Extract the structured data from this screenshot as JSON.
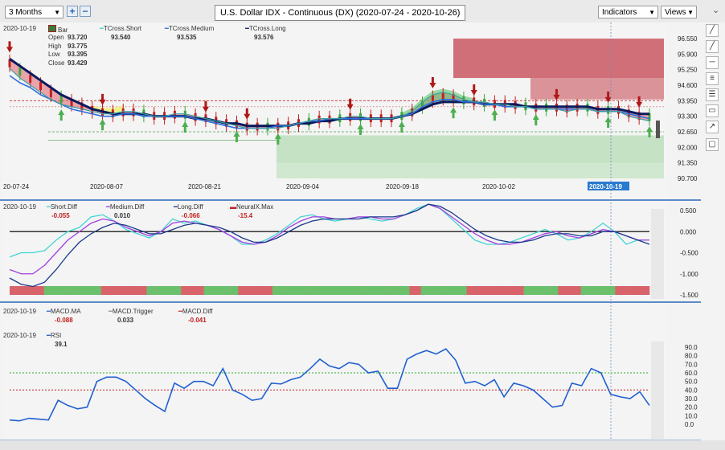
{
  "toolbar": {
    "period": "3 Months",
    "add": "+",
    "remove": "−",
    "title": "U.S. Dollar IDX - Continuous (DX) (2020-07-24 - 2020-10-26)",
    "indicators": "Indicators",
    "views": "Views"
  },
  "price_header": {
    "date": "2020-10-19",
    "bar_label": "Bar",
    "open_label": "Open",
    "open": "93.720",
    "high_label": "High",
    "high": "93.775",
    "low_label": "Low",
    "low": "93.395",
    "close_label": "Close",
    "close": "93.429",
    "tshort_label": "TCross.Short",
    "tshort": "93.540",
    "tmed_label": "TCross.Medium",
    "tmed": "93.535",
    "tlong_label": "TCross.Long",
    "tlong": "93.576"
  },
  "diff_header": {
    "date": "2020-10-19",
    "s_label": "Short.Diff",
    "s": "-0.055",
    "m_label": "Medium.Diff",
    "m": "0.010",
    "l_label": "Long.Diff",
    "l": "-0.066",
    "n_label": "NeuralX.Max",
    "n": "-15.4"
  },
  "macd_header": {
    "date": "2020-10-19",
    "ma_label": "MACD.MA",
    "ma": "-0.088",
    "trig_label": "MACD.Trigger",
    "trig": "0.033",
    "diff_label": "MACD.Diff",
    "diff": "-0.041"
  },
  "rsi_header": {
    "date": "2020-10-19",
    "label": "RSI",
    "value": "39.1"
  },
  "colors": {
    "short": "#45d4d4",
    "medium": "#2f6fe0",
    "long": "#0a1a5c",
    "up": "#3aa83a",
    "down": "#c22020",
    "macd_diff": "#d04040",
    "rsi": "#2060d0"
  },
  "chart_data": [
    {
      "type": "candlestick",
      "name": "price",
      "title": "U.S. Dollar IDX - Continuous (DX) (2020-07-24 - 2020-10-26)",
      "x_ticks": [
        "20-07-24",
        "2020-08-07",
        "2020-08-21",
        "2020-09-04",
        "2020-09-18",
        "2020-10-02",
        "2020-10-19"
      ],
      "y_ticks": [
        "96.550",
        "95.900",
        "95.250",
        "94.600",
        "93.950",
        "93.300",
        "92.650",
        "92.000",
        "91.350",
        "90.700"
      ],
      "ylim": [
        90.7,
        96.55
      ],
      "tcross_short": [
        95.3,
        94.9,
        94.6,
        94.3,
        94.0,
        93.8,
        93.7,
        93.6,
        93.5,
        93.4,
        93.4,
        93.5,
        93.5,
        93.4,
        93.3,
        93.3,
        93.4,
        93.4,
        93.3,
        93.2,
        93.1,
        93.0,
        92.9,
        92.8,
        92.8,
        92.8,
        92.8,
        92.9,
        93.0,
        93.1,
        93.2,
        93.2,
        93.2,
        93.3,
        93.3,
        93.2,
        93.2,
        93.2,
        93.3,
        93.5,
        93.9,
        94.2,
        94.3,
        94.2,
        94.0,
        93.9,
        93.9,
        93.8,
        93.8,
        93.7,
        93.7,
        93.6,
        93.6,
        93.6,
        93.5,
        93.6,
        93.6,
        93.5,
        93.5,
        93.5,
        93.3,
        93.2,
        93.1
      ],
      "tcross_medium": [
        95.0,
        94.7,
        94.5,
        94.2,
        94.0,
        93.8,
        93.6,
        93.5,
        93.4,
        93.3,
        93.3,
        93.4,
        93.4,
        93.3,
        93.3,
        93.3,
        93.3,
        93.3,
        93.2,
        93.1,
        93.0,
        92.9,
        92.8,
        92.8,
        92.8,
        92.8,
        92.9,
        92.9,
        93.0,
        93.1,
        93.1,
        93.2,
        93.2,
        93.2,
        93.2,
        93.2,
        93.2,
        93.2,
        93.3,
        93.4,
        93.7,
        93.9,
        94.0,
        94.0,
        93.9,
        93.9,
        93.8,
        93.8,
        93.7,
        93.7,
        93.7,
        93.6,
        93.6,
        93.6,
        93.6,
        93.6,
        93.6,
        93.5,
        93.5,
        93.5,
        93.4,
        93.3,
        93.2
      ],
      "tcross_long": [
        95.7,
        95.4,
        95.1,
        94.8,
        94.5,
        94.2,
        94.0,
        93.8,
        93.6,
        93.5,
        93.4,
        93.4,
        93.4,
        93.4,
        93.3,
        93.3,
        93.3,
        93.3,
        93.2,
        93.2,
        93.1,
        93.0,
        93.0,
        92.9,
        92.9,
        92.9,
        92.9,
        92.9,
        93.0,
        93.0,
        93.1,
        93.1,
        93.2,
        93.2,
        93.2,
        93.2,
        93.2,
        93.2,
        93.3,
        93.4,
        93.6,
        93.8,
        93.9,
        93.9,
        93.9,
        93.9,
        93.8,
        93.8,
        93.8,
        93.8,
        93.7,
        93.7,
        93.7,
        93.7,
        93.7,
        93.7,
        93.7,
        93.6,
        93.6,
        93.6,
        93.5,
        93.4,
        93.4
      ]
    },
    {
      "type": "line",
      "name": "diffs",
      "y_ticks": [
        "0.500",
        "0.000",
        "-0.500",
        "-1.000",
        "-1.500"
      ],
      "ylim": [
        -1.5,
        0.5
      ],
      "series": [
        {
          "name": "Short.Diff",
          "values": [
            -0.6,
            -0.5,
            -0.5,
            -0.45,
            -0.2,
            0,
            0.1,
            0.35,
            0.4,
            0.25,
            0.05,
            -0.05,
            -0.15,
            0,
            0.3,
            0.2,
            0.25,
            0.15,
            0.05,
            -0.1,
            -0.3,
            -0.3,
            -0.2,
            -0.05,
            0.15,
            0.35,
            0.4,
            0.3,
            0.25,
            0.3,
            0.35,
            0.3,
            0.25,
            0.3,
            0.4,
            0.55,
            0.65,
            0.55,
            0.3,
            0.05,
            -0.2,
            -0.3,
            -0.3,
            -0.25,
            -0.15,
            -0.05,
            0.05,
            -0.05,
            -0.2,
            -0.15,
            0.0,
            0.2,
            0.0,
            -0.3,
            -0.2,
            -0.2
          ]
        },
        {
          "name": "Medium.Diff",
          "values": [
            -0.9,
            -1.0,
            -1.0,
            -0.8,
            -0.5,
            -0.2,
            0.0,
            0.2,
            0.3,
            0.25,
            0.1,
            0.0,
            -0.1,
            0.0,
            0.2,
            0.25,
            0.2,
            0.15,
            0.05,
            -0.1,
            -0.25,
            -0.3,
            -0.25,
            -0.1,
            0.1,
            0.25,
            0.35,
            0.35,
            0.3,
            0.3,
            0.35,
            0.35,
            0.3,
            0.3,
            0.4,
            0.5,
            0.65,
            0.55,
            0.35,
            0.15,
            -0.05,
            -0.2,
            -0.3,
            -0.3,
            -0.25,
            -0.15,
            -0.05,
            0,
            -0.1,
            -0.15,
            -0.05,
            0.05,
            0.0,
            -0.1,
            -0.2,
            -0.2
          ]
        },
        {
          "name": "Long.Diff",
          "values": [
            -1.1,
            -1.25,
            -1.3,
            -1.2,
            -0.9,
            -0.55,
            -0.25,
            -0.05,
            0.1,
            0.2,
            0.15,
            0.05,
            -0.05,
            -0.05,
            0.05,
            0.15,
            0.2,
            0.15,
            0.1,
            0.0,
            -0.15,
            -0.25,
            -0.25,
            -0.15,
            0.0,
            0.15,
            0.25,
            0.3,
            0.3,
            0.3,
            0.3,
            0.35,
            0.35,
            0.35,
            0.4,
            0.5,
            0.65,
            0.6,
            0.45,
            0.25,
            0.05,
            -0.1,
            -0.2,
            -0.25,
            -0.25,
            -0.2,
            -0.1,
            -0.05,
            -0.05,
            -0.1,
            -0.1,
            0.0,
            0.0,
            -0.1,
            -0.2,
            -0.3
          ]
        }
      ]
    },
    {
      "type": "line",
      "name": "rsi",
      "y_ticks": [
        "90.0",
        "80.0",
        "70.0",
        "60.0",
        "50.0",
        "40.0",
        "30.0",
        "20.0",
        "10.0",
        "0.0"
      ],
      "ylim": [
        0,
        90
      ],
      "series": [
        {
          "name": "RSI",
          "values": [
            5,
            4,
            7,
            6,
            5,
            28,
            22,
            18,
            20,
            50,
            55,
            55,
            50,
            40,
            30,
            22,
            15,
            48,
            42,
            50,
            50,
            45,
            65,
            40,
            35,
            28,
            30,
            48,
            47,
            52,
            55,
            65,
            76,
            68,
            65,
            72,
            70,
            60,
            62,
            42,
            42,
            76,
            82,
            86,
            82,
            88,
            75,
            48,
            50,
            45,
            52,
            32,
            48,
            45,
            40,
            30,
            20,
            22,
            48,
            45,
            65,
            60,
            35,
            32,
            30,
            38,
            22
          ]
        }
      ],
      "levels": [
        60,
        40
      ]
    }
  ]
}
